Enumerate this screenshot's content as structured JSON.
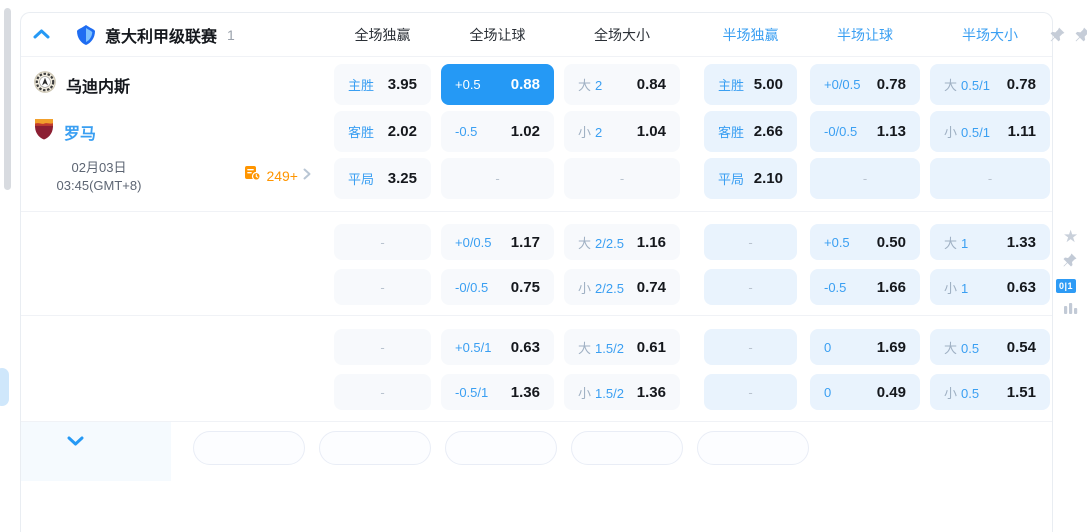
{
  "card": {
    "header": {
      "league_name": "意大利甲级联赛",
      "match_count": "1",
      "columns": [
        "全场独赢",
        "全场让球",
        "全场大小",
        "半场独赢",
        "半场让球",
        "半场大小"
      ]
    },
    "match": {
      "home_team": "乌迪内斯",
      "away_team": "罗马",
      "date": "02月03日",
      "time": "03:45(GMT+8)",
      "more_markets": "249+"
    },
    "odds_blocks": [
      {
        "rows": [
          {
            "cells": [
              {
                "label": "主胜",
                "value": "3.95"
              },
              {
                "label": "+0.5",
                "value": "0.88",
                "selected": true
              },
              {
                "prefix": "大",
                "label": "2",
                "value": "0.84"
              },
              {
                "label": "主胜",
                "value": "5.00"
              },
              {
                "label": "+0/0.5",
                "value": "0.78"
              },
              {
                "prefix": "大",
                "label": "0.5/1",
                "value": "0.78"
              }
            ]
          },
          {
            "cells": [
              {
                "label": "客胜",
                "value": "2.02"
              },
              {
                "label": "-0.5",
                "value": "1.02"
              },
              {
                "prefix": "小",
                "label": "2",
                "value": "1.04"
              },
              {
                "label": "客胜",
                "value": "2.66"
              },
              {
                "label": "-0/0.5",
                "value": "1.13"
              },
              {
                "prefix": "小",
                "label": "0.5/1",
                "value": "1.11"
              }
            ]
          },
          {
            "cells": [
              {
                "label": "平局",
                "value": "3.25"
              },
              {
                "dash": true
              },
              {
                "dash": true
              },
              {
                "label": "平局",
                "value": "2.10"
              },
              {
                "dash": true
              },
              {
                "dash": true
              }
            ]
          }
        ]
      },
      {
        "rows": [
          {
            "cells": [
              {
                "dash": true
              },
              {
                "label": "+0/0.5",
                "value": "1.17"
              },
              {
                "prefix": "大",
                "label": "2/2.5",
                "value": "1.16"
              },
              {
                "dash": true
              },
              {
                "label": "+0.5",
                "value": "0.50"
              },
              {
                "prefix": "大",
                "label": "1",
                "value": "1.33"
              }
            ]
          },
          {
            "cells": [
              {
                "dash": true
              },
              {
                "label": "-0/0.5",
                "value": "0.75"
              },
              {
                "prefix": "小",
                "label": "2/2.5",
                "value": "0.74"
              },
              {
                "dash": true
              },
              {
                "label": "-0.5",
                "value": "1.66"
              },
              {
                "prefix": "小",
                "label": "1",
                "value": "0.63"
              }
            ]
          }
        ]
      },
      {
        "rows": [
          {
            "cells": [
              {
                "dash": true
              },
              {
                "label": "+0.5/1",
                "value": "0.63"
              },
              {
                "prefix": "大",
                "label": "1.5/2",
                "value": "0.61"
              },
              {
                "dash": true
              },
              {
                "label": "0",
                "value": "1.69"
              },
              {
                "prefix": "大",
                "label": "0.5",
                "value": "0.54"
              }
            ]
          },
          {
            "cells": [
              {
                "dash": true
              },
              {
                "label": "-0.5/1",
                "value": "1.36"
              },
              {
                "prefix": "小",
                "label": "1.5/2",
                "value": "1.36"
              },
              {
                "dash": true
              },
              {
                "label": "0",
                "value": "0.49"
              },
              {
                "prefix": "小",
                "label": "0.5",
                "value": "1.51"
              }
            ]
          }
        ]
      }
    ],
    "footer": {
      "pill_count": 5
    }
  },
  "side_tools": {
    "stat_badge": "0|1"
  },
  "colors": {
    "accent_blue": "#2599f5",
    "selected_cell_bg": "#2599f5",
    "half_market_bg": "#e9f3fd",
    "full_market_bg": "#f7f9fc",
    "orange": "#ff9500"
  }
}
